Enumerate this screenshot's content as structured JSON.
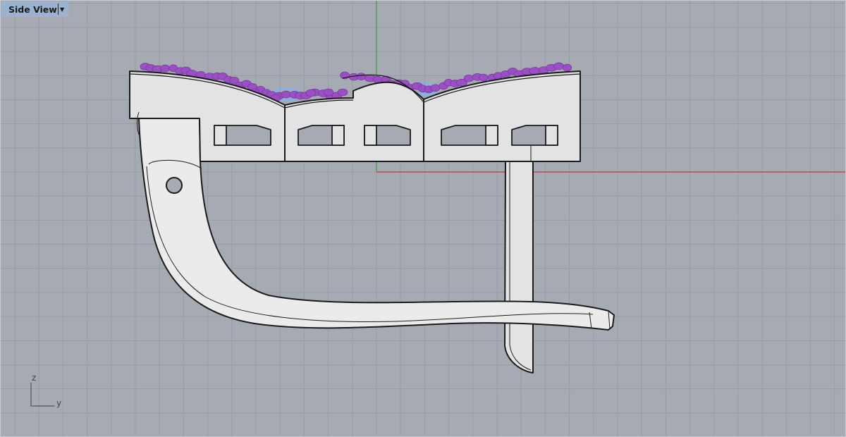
{
  "viewport": {
    "title": "Side View",
    "menu_icon": "triangle-down-icon",
    "axis_labels": {
      "vertical": "z",
      "horizontal": "y"
    }
  },
  "colors": {
    "background": "#a6abb3",
    "grid": "#979ca4",
    "x_axis": "#c0393a",
    "z_axis": "#3aa03a",
    "model_fill": "#e6e6e6",
    "gems": "#9b4fc4",
    "settings": "#7fb3ea"
  }
}
